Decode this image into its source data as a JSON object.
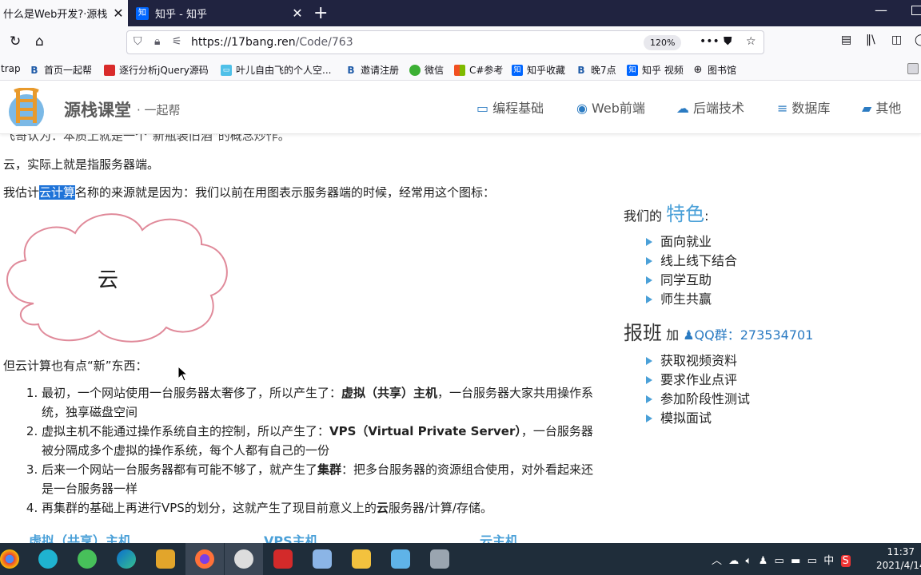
{
  "browser": {
    "tabs": [
      {
        "title": "什么是Web开发?·源栈",
        "active": true
      },
      {
        "title": "知乎 - 知乎",
        "active": false,
        "favicon": "知"
      }
    ],
    "url_host": "https://17bang.ren",
    "url_path": "/Code/763",
    "zoom": "120%",
    "bookmarks": [
      {
        "label": "trap"
      },
      {
        "label": "首页一起帮"
      },
      {
        "label": "逐行分析jQuery源码"
      },
      {
        "label": "叶儿自由飞的个人空..."
      },
      {
        "label": "邀请注册"
      },
      {
        "label": "微信"
      },
      {
        "label": "C#参考"
      },
      {
        "label": "知乎收藏"
      },
      {
        "label": "晚7点"
      },
      {
        "label": "知乎 视频"
      },
      {
        "label": "图书馆"
      }
    ],
    "accent": "#202340"
  },
  "site": {
    "brand": "源栈课堂",
    "tagline": "· 一起帮",
    "nav": [
      {
        "label": "编程基础",
        "icon": "laptop-icon"
      },
      {
        "label": "Web前端",
        "icon": "chrome-icon"
      },
      {
        "label": "后端技术",
        "icon": "cloud-icon"
      },
      {
        "label": "数据库",
        "icon": "database-icon"
      },
      {
        "label": "其他",
        "icon": "book-icon"
      }
    ]
  },
  "article": {
    "line_cut": "飞哥认为：本质上就是一个\"新瓶装旧酒\"的概念炒作。",
    "p1": "云，实际上就是指服务器端。",
    "p2_before": "我估计",
    "p2_highlight": "云计算",
    "p2_after": "名称的来源就是因为：我们以前在用图表示服务器端的时候，经常用这个图标：",
    "cloud_label": "云",
    "p3": "但云计算也有点“新”东西：",
    "list": [
      {
        "a": "最初，一个网站使用一台服务器太奢侈了，所以产生了：",
        "b": "虚拟（共享）主机",
        "c": "，一台服务器大家共用操作系统，独享磁盘空间"
      },
      {
        "a": "虚拟主机不能通过操作系统自主的控制，所以产生了：",
        "b": "VPS（Virtual Private Server）",
        "c": "，一台服务器被分隔成多个虚拟的操作系统，每个人都有自己的一份"
      },
      {
        "a": "后来一个网站一台服务器都有可能不够了，就产生了",
        "b": "集群",
        "c": "：把多台服务器的资源组合使用，对外看起来还是一台服务器一样"
      },
      {
        "a": "再集群的基础上再进行VPS的划分，这就产生了现目前意义上的",
        "b": "云",
        "c": "服务器/计算/存储。"
      }
    ],
    "sub_heads": [
      "虚拟（共享）主机",
      "VPS主机",
      "云主机"
    ]
  },
  "sidebar": {
    "features_prefix": "我们的",
    "features_big": "特色",
    "features_suffix": ":",
    "features": [
      "面向就业",
      "线上线下结合",
      "同学互助",
      "师生共赢"
    ],
    "signup_big": "报班",
    "signup_small": "加",
    "qq_label": "QQ群：273534701",
    "benefits": [
      "获取视频资料",
      "要求作业点评",
      "参加阶段性测试",
      "模拟面试"
    ]
  },
  "taskbar": {
    "ime": "中",
    "time": "11:37",
    "date": "2021/4/14"
  }
}
